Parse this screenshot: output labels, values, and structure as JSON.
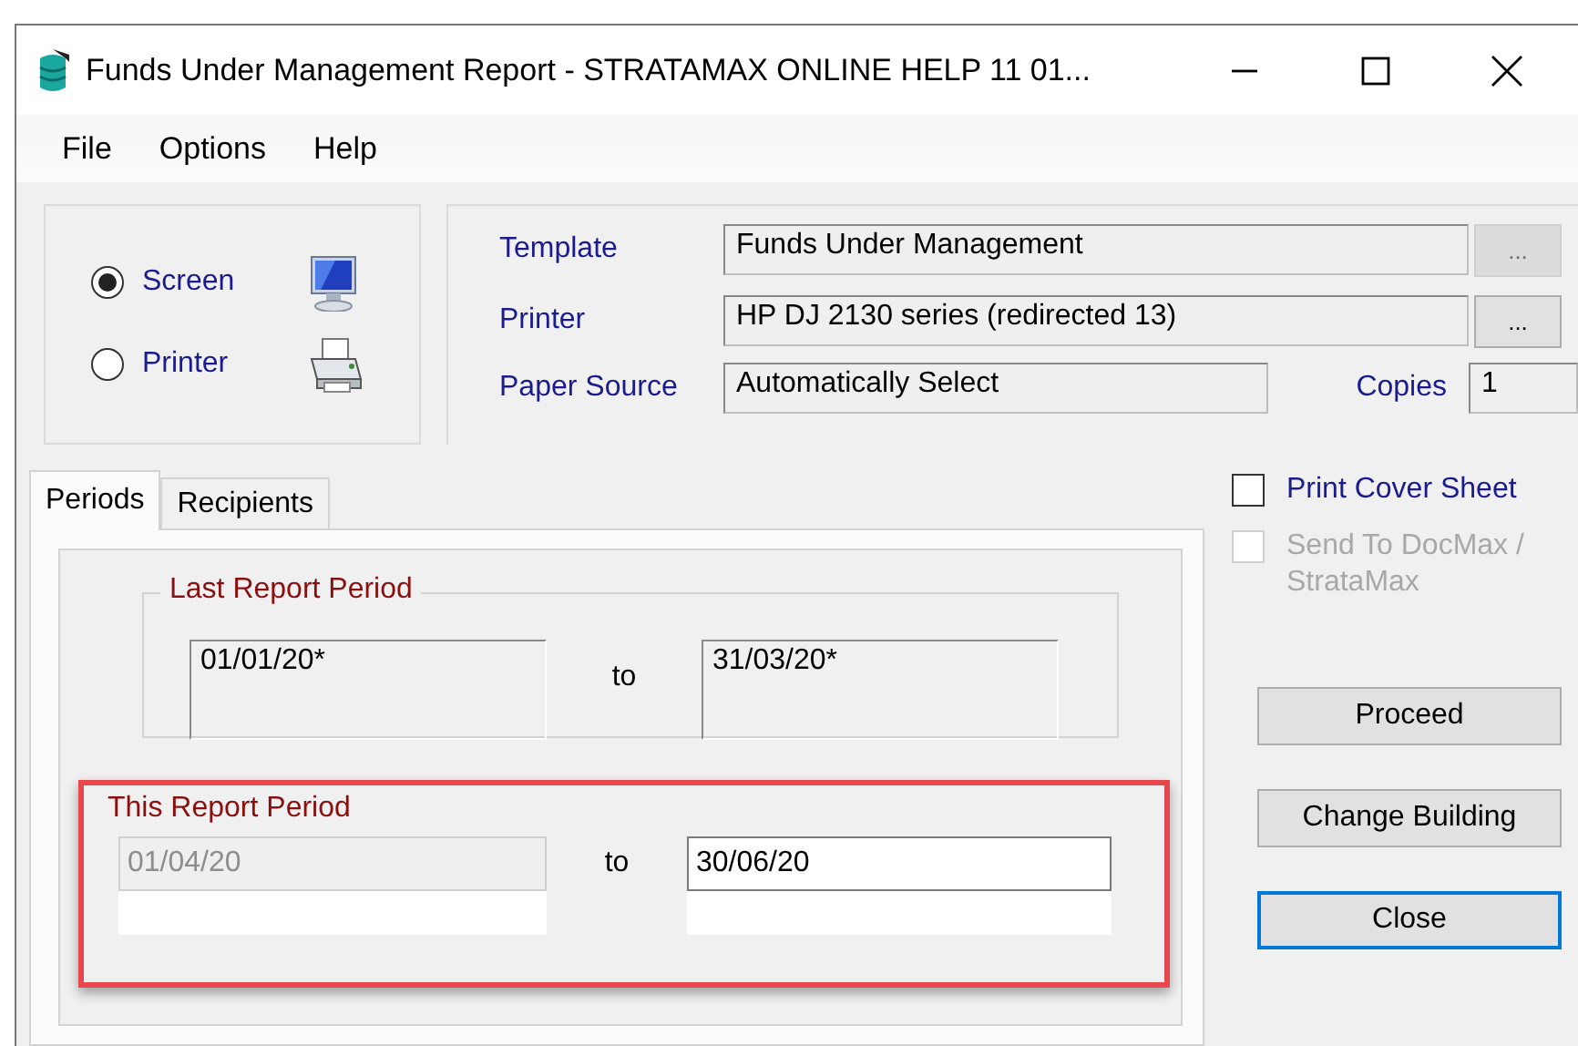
{
  "window": {
    "title": "Funds Under Management Report - STRATAMAX ONLINE HELP 11 01..."
  },
  "menu": [
    "File",
    "Options",
    "Help"
  ],
  "output": [
    {
      "label": "Screen",
      "selected": true,
      "kind": "screen"
    },
    {
      "label": "Printer",
      "selected": false,
      "kind": "printer"
    }
  ],
  "settings": {
    "template": {
      "label": "Template",
      "value": "Funds Under Management",
      "browse": "...",
      "browse_disabled": true
    },
    "printer": {
      "label": "Printer",
      "value": "HP DJ 2130 series (redirected 13)",
      "browse": "...",
      "browse_disabled": false
    },
    "paper_source": {
      "label": "Paper Source",
      "value": "Automatically Select"
    },
    "copies": {
      "label": "Copies",
      "value": "1"
    }
  },
  "tabs": [
    {
      "label": "Periods",
      "selected": true
    },
    {
      "label": "Recipients",
      "selected": false
    }
  ],
  "last_period": {
    "title": "Last Report Period",
    "from": "01/01/20*",
    "to_label": "to",
    "to": "31/03/20*"
  },
  "this_period": {
    "title": "This Report Period",
    "from": "01/04/20",
    "from_disabled": true,
    "to_label": "to",
    "to": "30/06/20",
    "highlighted": true
  },
  "options": [
    {
      "label": "Print Cover Sheet",
      "checked": false,
      "disabled": false
    },
    {
      "label": "Send To DocMax / StrataMax",
      "checked": false,
      "disabled": true
    }
  ],
  "buttons": [
    {
      "label": "Proceed",
      "focused": false
    },
    {
      "label": "Change Building",
      "focused": false
    },
    {
      "label": "Close",
      "focused": true
    }
  ]
}
